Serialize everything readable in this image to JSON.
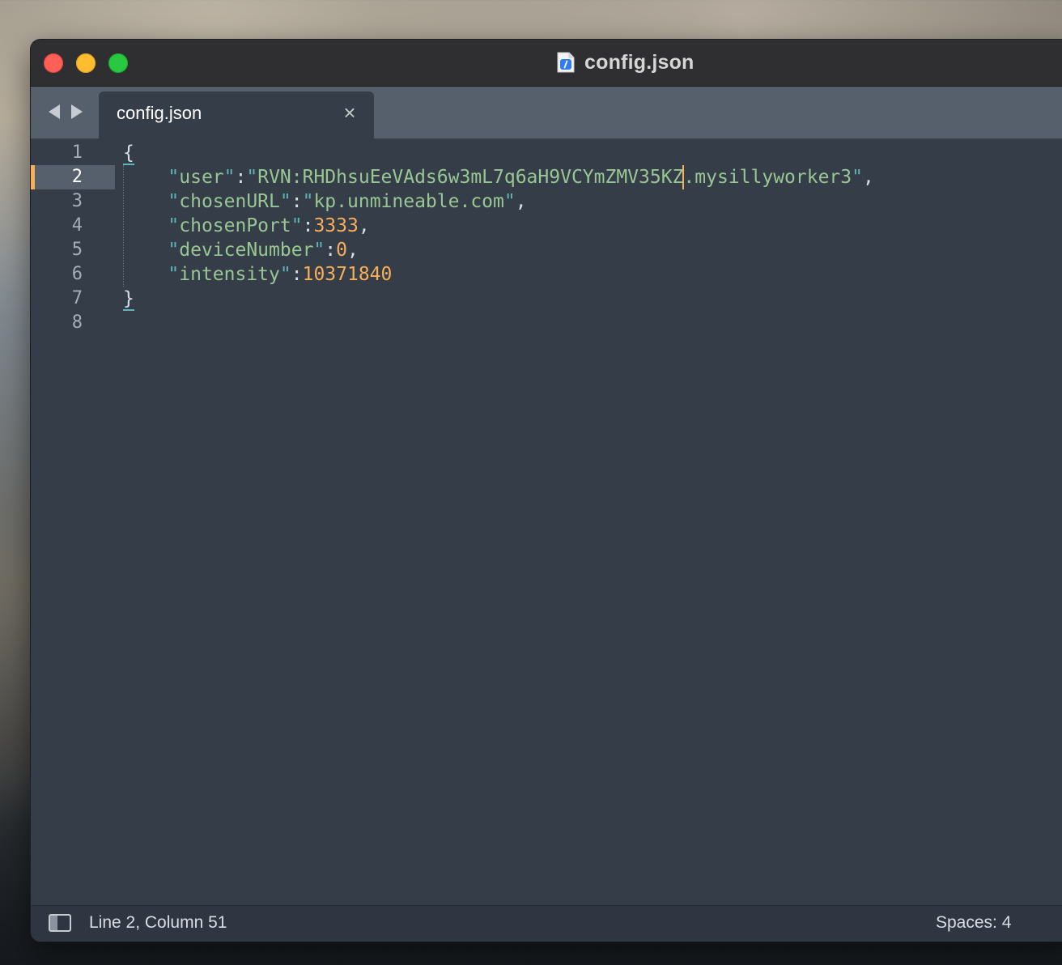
{
  "window": {
    "title": "config.json"
  },
  "tabs": [
    {
      "label": "config.json",
      "close_glyph": "×",
      "active": true
    }
  ],
  "editor": {
    "line_numbers": [
      "1",
      "2",
      "3",
      "4",
      "5",
      "6",
      "7",
      "8"
    ],
    "active_line": 2,
    "lines": [
      {
        "open_brace": "{"
      },
      {
        "indent": "    ",
        "q1": "\"",
        "key": "user",
        "q2": "\"",
        "colon": ":",
        "q3": "\"",
        "value_before_caret": "RVN:RHDhsuEeVAds6w3mL7q6aH9VCYmZMV35KZ",
        "value_after_caret": ".mysillyworker3",
        "q4": "\"",
        "comma": ","
      },
      {
        "indent": "    ",
        "q1": "\"",
        "key": "chosenURL",
        "q2": "\"",
        "colon": ":",
        "q3": "\"",
        "value": "kp.unmineable.com",
        "q4": "\"",
        "comma": ","
      },
      {
        "indent": "    ",
        "q1": "\"",
        "key": "chosenPort",
        "q2": "\"",
        "colon": ":",
        "value": "3333",
        "comma": ","
      },
      {
        "indent": "    ",
        "q1": "\"",
        "key": "deviceNumber",
        "q2": "\"",
        "colon": ":",
        "value": "0",
        "comma": ","
      },
      {
        "indent": "    ",
        "q1": "\"",
        "key": "intensity",
        "q2": "\"",
        "colon": ":",
        "value": "10371840"
      },
      {
        "close_brace": "}"
      },
      {}
    ]
  },
  "statusbar": {
    "position": "Line 2, Column 51",
    "indentation": "Spaces: 4"
  },
  "colors": {
    "editor_bg": "#343d48",
    "tab_bar_bg": "#56606d",
    "string": "#99c794",
    "number": "#f9ae58",
    "quote": "#5fb4b4",
    "caret": "#f9ae58",
    "traffic_close": "#fe5f57",
    "traffic_minimize": "#febc2e",
    "traffic_maximize": "#28c840"
  },
  "icons": {
    "file": "json-file-icon",
    "back": "triangle-left-icon",
    "forward": "triangle-right-icon",
    "sidebar": "sidebar-toggle-icon"
  }
}
